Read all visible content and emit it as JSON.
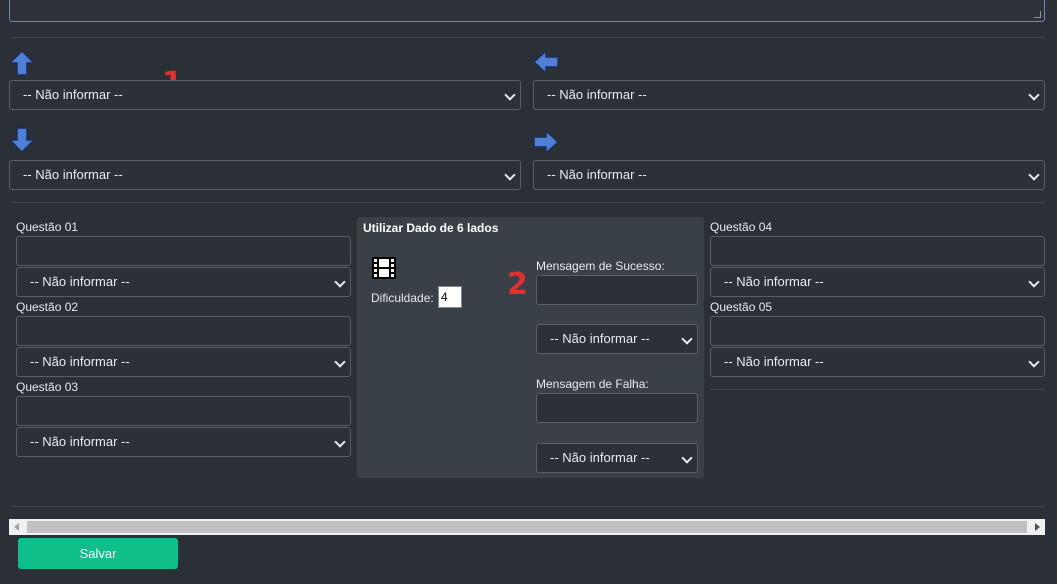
{
  "select_default": "-- Não informar --",
  "markers": {
    "one": "1",
    "two": "2"
  },
  "directions": {
    "up": {
      "icon": "arrow-up-icon",
      "value": "-- Não informar --"
    },
    "left": {
      "icon": "arrow-left-icon",
      "value": "-- Não informar --"
    },
    "down": {
      "icon": "arrow-down-icon",
      "value": "-- Não informar --"
    },
    "right": {
      "icon": "arrow-right-icon",
      "value": "-- Não informar --"
    }
  },
  "questions": [
    {
      "label": "Questão 01",
      "select": "-- Não informar --"
    },
    {
      "label": "Questão 02",
      "select": "-- Não informar --"
    },
    {
      "label": "Questão 03",
      "select": "-- Não informar --"
    },
    {
      "label": "Questão 04",
      "select": "-- Não informar --"
    },
    {
      "label": "Questão 05",
      "select": "-- Não informar --"
    }
  ],
  "dice": {
    "title": "Utilizar Dado de 6 lados",
    "icon": "film-icon",
    "difficulty_label": "Dificuldade:",
    "difficulty_value": "4",
    "success_label": "Mensagem de Sucesso:",
    "success_select": "-- Não informar --",
    "failure_label": "Mensagem de Falha:",
    "failure_select": "-- Não informar --"
  },
  "save_label": "Salvar",
  "colors": {
    "arrow": "#4f7fd6",
    "save": "#0fbf8a",
    "marker": "#e03131"
  }
}
